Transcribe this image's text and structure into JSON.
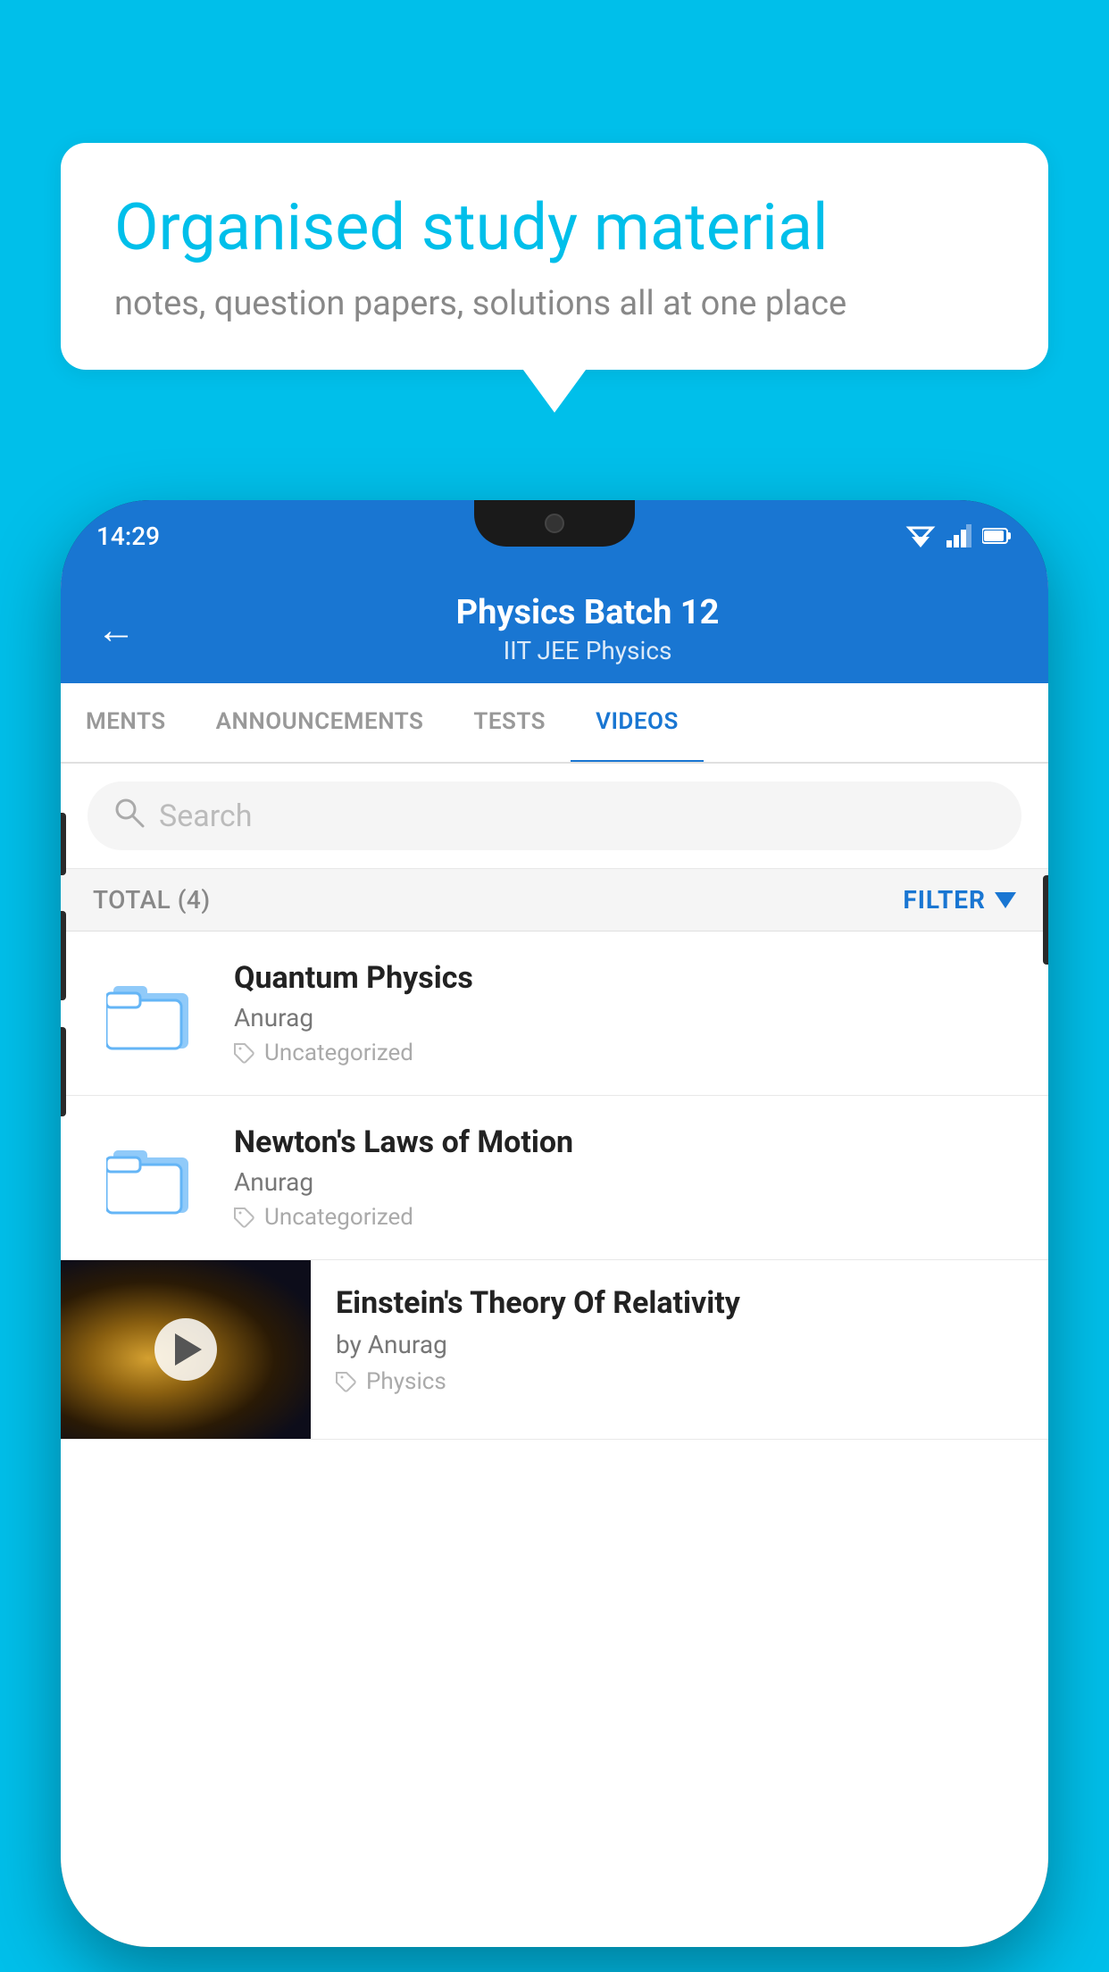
{
  "background": {
    "color": "#00BFEA"
  },
  "speech_bubble": {
    "title": "Organised study material",
    "subtitle": "notes, question papers, solutions all at one place"
  },
  "phone": {
    "status_bar": {
      "time": "14:29",
      "wifi": "▼▲",
      "battery": "🔋"
    },
    "header": {
      "back_label": "←",
      "title": "Physics Batch 12",
      "subtitle_tags": "IIT JEE    Physics"
    },
    "tabs": [
      {
        "label": "MENTS",
        "active": false
      },
      {
        "label": "ANNOUNCEMENTS",
        "active": false
      },
      {
        "label": "TESTS",
        "active": false
      },
      {
        "label": "VIDEOS",
        "active": true
      }
    ],
    "search": {
      "placeholder": "Search"
    },
    "filter_bar": {
      "total_label": "TOTAL (4)",
      "filter_label": "FILTER"
    },
    "video_items": [
      {
        "title": "Quantum Physics",
        "author": "Anurag",
        "tag": "Uncategorized",
        "type": "folder"
      },
      {
        "title": "Newton's Laws of Motion",
        "author": "Anurag",
        "tag": "Uncategorized",
        "type": "folder"
      },
      {
        "title": "Einstein's Theory Of Relativity",
        "author": "by Anurag",
        "tag": "Physics",
        "type": "video"
      }
    ]
  }
}
